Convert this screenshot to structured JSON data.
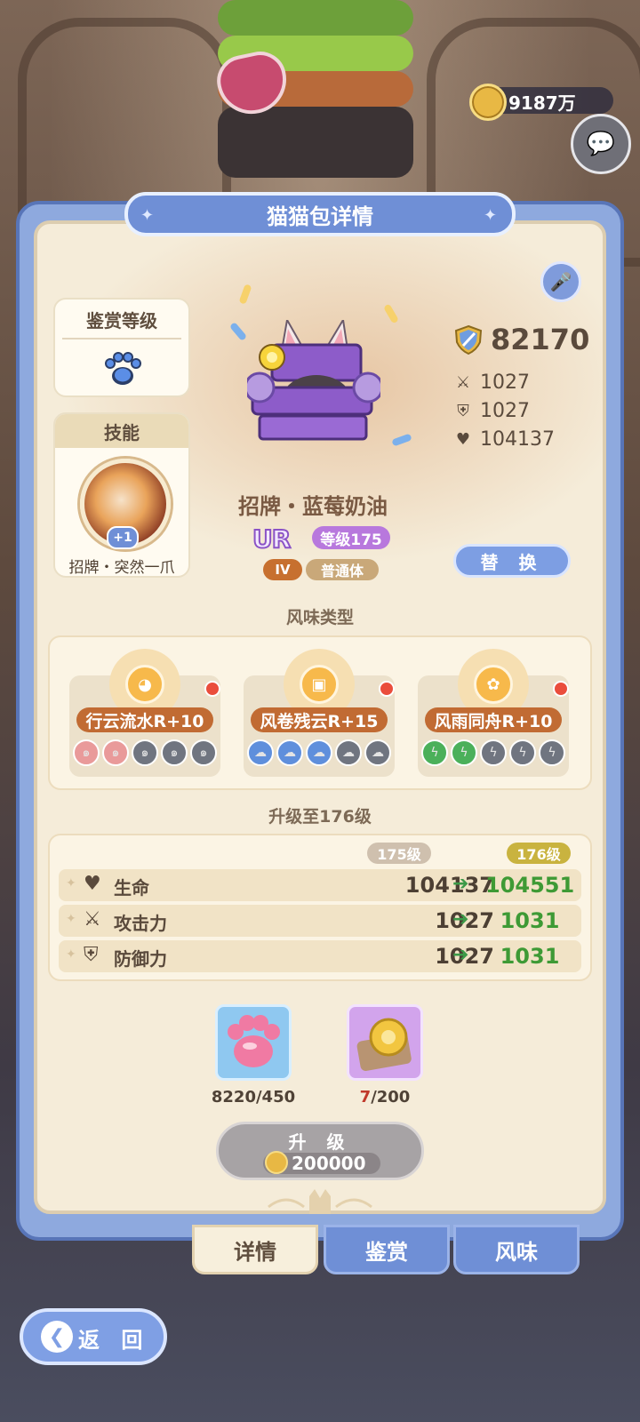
{
  "top": {
    "coins": "9187万"
  },
  "panel": {
    "title": "猫猫包详情"
  },
  "appraise": {
    "title": "鉴赏等级"
  },
  "skill": {
    "title": "技能",
    "plus": "+1",
    "name": "招牌・突然一爪"
  },
  "cat": {
    "power": "82170",
    "attack": "1027",
    "defense": "1027",
    "hp": "104137",
    "name": "招牌・蓝莓奶油",
    "rarity": "UR",
    "level": "等级175",
    "tier": "IV",
    "body_type": "普通体",
    "replace_label": "替 换"
  },
  "flavor": {
    "title": "风味类型",
    "cards": [
      {
        "label": "行云流水R+10",
        "icon": "cat-face-icon",
        "slot_icon": "tornado-icon",
        "slots_filled": 2
      },
      {
        "label": "风卷残云R+15",
        "icon": "music-box-icon",
        "slot_icon": "storm-cloud-icon",
        "slots_filled": 3
      },
      {
        "label": "风雨同舟R+10",
        "icon": "fox-icon",
        "slot_icon": "lightning-icon",
        "slots_filled": 2
      }
    ]
  },
  "upgrade": {
    "title": "升级至176级",
    "current_level": "175级",
    "next_level": "176级",
    "rows": [
      {
        "name": "生命",
        "icon": "heart-icon",
        "current": "104137",
        "next": "104551"
      },
      {
        "name": "攻击力",
        "icon": "crossed-swords-icon",
        "current": "1027",
        "next": "1031"
      },
      {
        "name": "防御力",
        "icon": "shield-icon",
        "current": "1027",
        "next": "1031"
      }
    ],
    "materials": [
      {
        "icon": "pink-paw-jelly-icon",
        "qty": "8220/450"
      },
      {
        "icon": "golden-bread-icon",
        "have": "7",
        "need": "/200"
      }
    ],
    "button_label": "升 级",
    "cost": "200000"
  },
  "tabs": [
    "详情",
    "鉴赏",
    "风味"
  ],
  "back_label": "返 回",
  "colors": {
    "panel_blue": "#8ea9de",
    "panel_cream": "#f5ecd9",
    "flavor_label": "#c16b33",
    "increase_green": "#3e9a35",
    "level_purple": "#b878dd"
  }
}
